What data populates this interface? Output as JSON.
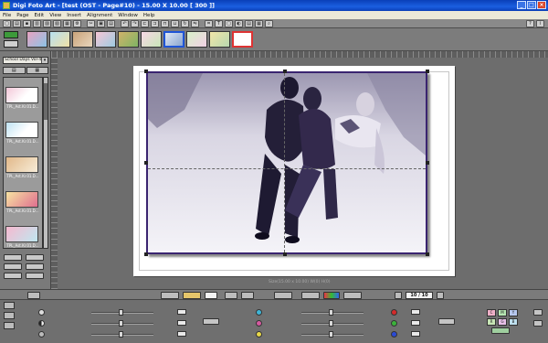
{
  "window": {
    "title": "Digi Foto Art - [test (OST - Page#10) - 15.00 X 10.00 [ 300 ]]"
  },
  "menu": [
    "File",
    "Page",
    "Edit",
    "View",
    "Insert",
    "Alignment",
    "Window",
    "Help"
  ],
  "page_strip": {
    "thumbnail_count": 10,
    "selected_index": 6
  },
  "left_panel": {
    "template_select": "School Days Vol-43",
    "tabs": [
      "▤",
      "▦"
    ],
    "items": [
      {
        "caption": "TPL_Ast.Kr.01.D..."
      },
      {
        "caption": "TPL_Ast.Kr.01.D..."
      },
      {
        "caption": "TPL_Ast.Kr.01.D..."
      },
      {
        "caption": "TPL_Ast.Kr.01.D..."
      },
      {
        "caption": "TPL_Ast.Kr.01.D..."
      }
    ]
  },
  "canvas": {
    "size_label": "Size(15.00 x 10.00) W(0) H(0)",
    "page_counter": "10 / 10"
  },
  "colors": {
    "accent_blue": "#1f55d6",
    "frame_border": "#3a2470",
    "title_bar": "#0a3fb8"
  },
  "bottom": {
    "color_dots": [
      "#3fb5d6",
      "#d55aa0",
      "#e8d84a"
    ],
    "status_dots": [
      "#d42a2a",
      "#3bb23b",
      "#2a4ad4"
    ],
    "swatches": [
      "#efb0c8",
      "#b6e6b2",
      "#b7c8ef",
      "#c8e6b6",
      "#e8c0e8",
      "#bfe0ef"
    ]
  }
}
